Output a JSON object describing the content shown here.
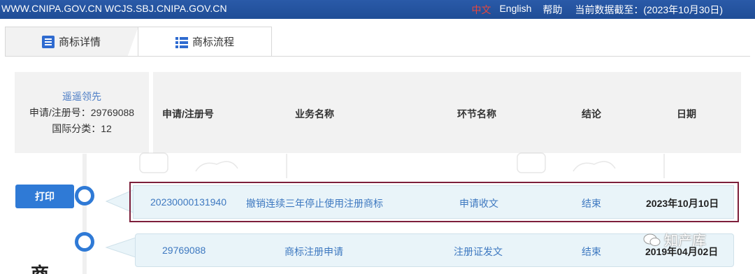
{
  "topbar": {
    "sites": "WWW.CNIPA.GOV.CN WCJS.SBJ.CNIPA.GOV.CN",
    "lang_cn": "中文",
    "lang_en": "English",
    "help": "帮助",
    "data_date": "当前数据截至：(2023年10月30日)"
  },
  "tabs": [
    {
      "label": "商标详情",
      "icon": "document-icon"
    },
    {
      "label": "商标流程",
      "icon": "list-icon"
    }
  ],
  "info": {
    "name": "遥遥领先",
    "reg_no": "申请/注册号：29769088",
    "intl_class": "国际分类：12"
  },
  "table": {
    "headers": [
      "申请/注册号",
      "业务名称",
      "环节名称",
      "结论",
      "日期"
    ],
    "rows": [
      {
        "reg_no": "20230000131940",
        "business": "撤销连续三年停止使用注册商标",
        "stage": "申请收文",
        "result": "结束",
        "date": "2023年10月10日"
      },
      {
        "reg_no": "29769088",
        "business": "商标注册申请",
        "stage": "注册证发文",
        "result": "结束",
        "date": "2019年04月02日"
      }
    ]
  },
  "print_label": "打印",
  "bottom_char": "商",
  "watermark": "知产库",
  "colors": {
    "topbar": "#1f4d96",
    "accent": "#2f7ad6",
    "highlight": "#7d1f3b",
    "row_bg": "#e9f4f9"
  }
}
